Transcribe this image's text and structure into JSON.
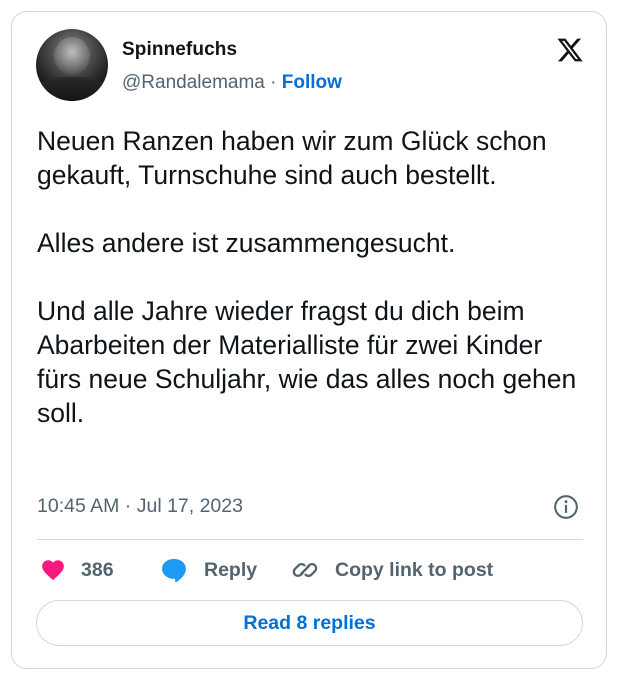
{
  "author": {
    "name": "Spinnefuchs",
    "handle": "@Randalemama",
    "separator": " · ",
    "follow_label": "Follow"
  },
  "tweet": {
    "paragraphs": [
      "Neuen Ranzen haben wir zum Glück schon gekauft, Turnschuhe sind auch bestellt.",
      "Alles andere ist zusammengesucht.",
      "Und alle Jahre wieder fragst du dich beim Abarbeiten der Materialliste für zwei Kinder fürs neue Schuljahr, wie das alles noch gehen soll."
    ],
    "timestamp": "10:45 AM · Jul 17, 2023"
  },
  "actions": {
    "like_count": "386",
    "reply_label": "Reply",
    "copy_label": "Copy link to post"
  },
  "read_replies_label": "Read 8 replies",
  "icons": {
    "logo": "x-logo-icon",
    "info": "info-icon",
    "like": "heart-icon",
    "reply": "speech-bubble-icon",
    "copy": "link-icon"
  },
  "colors": {
    "accent": "#006fd6",
    "like": "#f91880",
    "reply": "#1d9bf0",
    "muted": "#536471",
    "border": "#cfd9de"
  }
}
